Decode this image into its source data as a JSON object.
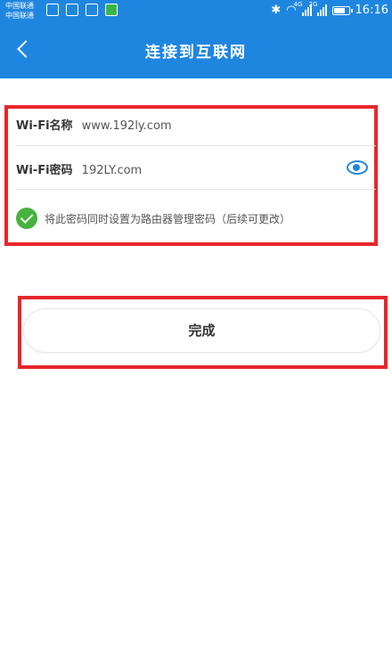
{
  "status_bar": {
    "carrier_line1": "中国联通",
    "carrier_line2": "中国联通",
    "net1": "4G",
    "net2": "2G",
    "time": "16:16"
  },
  "header": {
    "title": "连接到互联网"
  },
  "form": {
    "ssid_label": "Wi-Fi名称",
    "ssid_value": "www.192ly.com",
    "password_label": "Wi-Fi密码",
    "password_value": "192LY.com",
    "sync_note": "将此密码同时设置为路由器管理密码（后续可更改）"
  },
  "actions": {
    "done_label": "完成"
  },
  "colors": {
    "brand": "#1f86e0",
    "check": "#46b33c",
    "highlight": "#e8262b"
  }
}
